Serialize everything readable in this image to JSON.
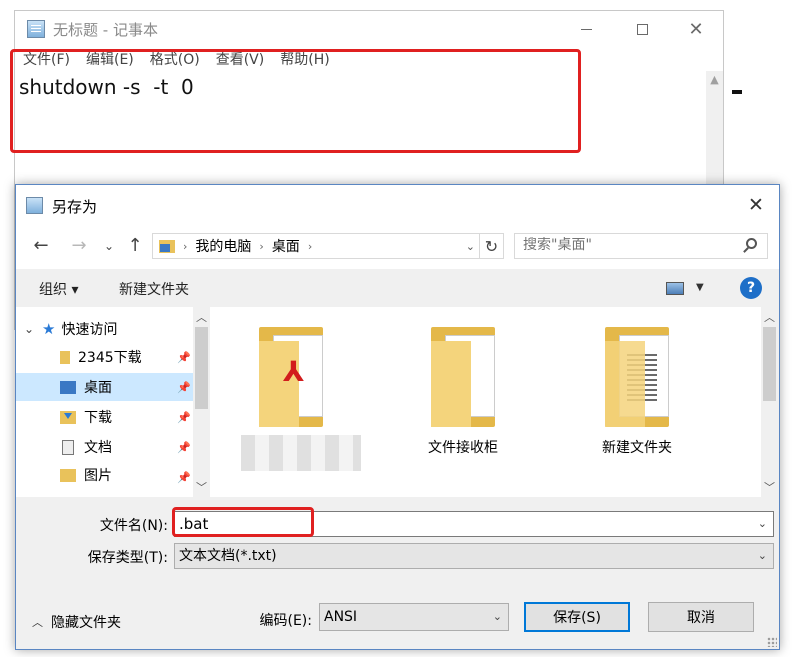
{
  "notepad": {
    "title": "无标题 - 记事本",
    "menu": [
      "文件(F)",
      "编辑(E)",
      "格式(O)",
      "查看(V)",
      "帮助(H)"
    ],
    "content": "shutdown -s  -t  0"
  },
  "dialog": {
    "title": "另存为",
    "breadcrumb": [
      "我的电脑",
      "桌面"
    ],
    "search_placeholder": "搜索\"桌面\"",
    "toolbar": {
      "organize": "组织 ▾",
      "new_folder": "新建文件夹",
      "help": "?"
    },
    "nav": [
      {
        "label": "快速访问",
        "icon": "star-icon"
      },
      {
        "label": "2345下载",
        "icon": "folder-icon"
      },
      {
        "label": "桌面",
        "icon": "desktop-folder-icon",
        "selected": true
      },
      {
        "label": "下载",
        "icon": "download-folder-icon"
      },
      {
        "label": "文档",
        "icon": "document-icon"
      },
      {
        "label": "图片",
        "icon": "pictures-folder-icon"
      }
    ],
    "files": [
      {
        "name": "",
        "icon": "pdf-folder-icon"
      },
      {
        "name": "文件接收柜",
        "icon": "folder-icon"
      },
      {
        "name": "新建文件夹",
        "icon": "folder-icon"
      }
    ],
    "filename_label": "文件名(N):",
    "filename_value": ".bat",
    "filetype_label": "保存类型(T):",
    "filetype_value": "文本文档(*.txt)",
    "hide_folders": "隐藏文件夹",
    "encoding_label": "编码(E):",
    "encoding_value": "ANSI",
    "save_button": "保存(S)",
    "cancel_button": "取消"
  },
  "colors": {
    "highlight_box": "#e02020",
    "selection": "#cce8ff",
    "primary_button_border": "#0078d7"
  }
}
